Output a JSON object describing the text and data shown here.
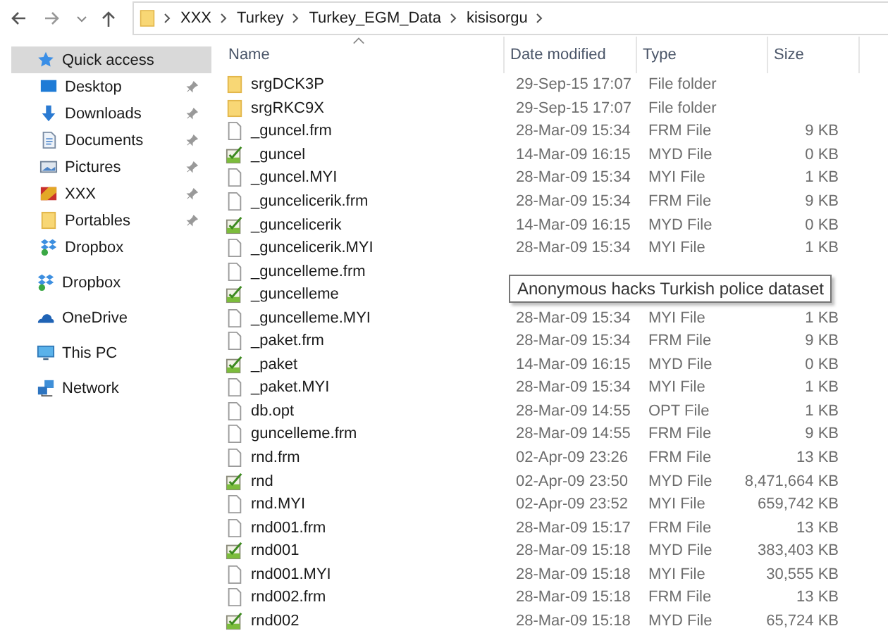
{
  "address_bar": {
    "crumbs": [
      "XXX",
      "Turkey",
      "Turkey_EGM_Data",
      "kisisorgu"
    ]
  },
  "sidebar": {
    "items": [
      {
        "label": "Quick access",
        "kind": "star",
        "selected": true,
        "children": [
          {
            "label": "Desktop",
            "kind": "desktop",
            "pinned": true
          },
          {
            "label": "Downloads",
            "kind": "download",
            "pinned": true
          },
          {
            "label": "Documents",
            "kind": "document",
            "pinned": true
          },
          {
            "label": "Pictures",
            "kind": "pictures",
            "pinned": true
          },
          {
            "label": "XXX",
            "kind": "app",
            "pinned": true
          },
          {
            "label": "Portables",
            "kind": "folder",
            "pinned": true
          },
          {
            "label": "Dropbox",
            "kind": "dropbox",
            "pinned": false
          }
        ]
      },
      {
        "label": "Dropbox",
        "kind": "dropbox",
        "selected": false
      },
      {
        "label": "OneDrive",
        "kind": "cloud",
        "selected": false
      },
      {
        "label": "This PC",
        "kind": "pc",
        "selected": false
      },
      {
        "label": "Network",
        "kind": "network",
        "selected": false
      }
    ]
  },
  "table": {
    "columns": [
      "Name",
      "Date modified",
      "Type",
      "Size"
    ],
    "rows": [
      {
        "kind": "folder",
        "name": "srgDCK3P",
        "date": "29-Sep-15 17:07",
        "type": "File folder"
      },
      {
        "kind": "folder",
        "name": "srgRKC9X",
        "date": "29-Sep-15 17:07",
        "type": "File folder"
      },
      {
        "kind": "file",
        "name": "_guncel.frm",
        "date": "28-Mar-09 15:34",
        "type": "FRM File",
        "size": "9 KB"
      },
      {
        "kind": "data",
        "name": "_guncel",
        "date": "14-Mar-09 16:15",
        "type": "MYD File",
        "size": "0 KB"
      },
      {
        "kind": "file",
        "name": "_guncel.MYI",
        "date": "28-Mar-09 15:34",
        "type": "MYI File",
        "size": "1 KB"
      },
      {
        "kind": "file",
        "name": "_guncelicerik.frm",
        "date": "28-Mar-09 15:34",
        "type": "FRM File",
        "size": "9 KB"
      },
      {
        "kind": "data",
        "name": "_guncelicerik",
        "date": "14-Mar-09 16:15",
        "type": "MYD File",
        "size": "0 KB"
      },
      {
        "kind": "file",
        "name": "_guncelicerik.MYI",
        "date": "28-Mar-09 15:34",
        "type": "MYI File",
        "size": "1 KB"
      },
      {
        "kind": "file",
        "name": "_guncelleme.frm"
      },
      {
        "kind": "data",
        "name": "_guncelleme"
      },
      {
        "kind": "file",
        "name": "_guncelleme.MYI",
        "date": "28-Mar-09 15:34",
        "type": "MYI File",
        "size": "1 KB"
      },
      {
        "kind": "file",
        "name": "_paket.frm",
        "date": "28-Mar-09 15:34",
        "type": "FRM File",
        "size": "9 KB"
      },
      {
        "kind": "data",
        "name": "_paket",
        "date": "14-Mar-09 16:15",
        "type": "MYD File",
        "size": "0 KB"
      },
      {
        "kind": "file",
        "name": "_paket.MYI",
        "date": "28-Mar-09 15:34",
        "type": "MYI File",
        "size": "1 KB"
      },
      {
        "kind": "file",
        "name": "db.opt",
        "date": "28-Mar-09 14:55",
        "type": "OPT File",
        "size": "1 KB"
      },
      {
        "kind": "file",
        "name": "guncelleme.frm",
        "date": "28-Mar-09 14:55",
        "type": "FRM File",
        "size": "9 KB"
      },
      {
        "kind": "file",
        "name": "rnd.frm",
        "date": "02-Apr-09 23:26",
        "type": "FRM File",
        "size": "13 KB"
      },
      {
        "kind": "data",
        "name": "rnd",
        "date": "02-Apr-09 23:50",
        "type": "MYD File",
        "size": "8,471,664 KB"
      },
      {
        "kind": "file",
        "name": "rnd.MYI",
        "date": "02-Apr-09 23:52",
        "type": "MYI File",
        "size": "659,742 KB"
      },
      {
        "kind": "file",
        "name": "rnd001.frm",
        "date": "28-Mar-09 15:17",
        "type": "FRM File",
        "size": "13 KB"
      },
      {
        "kind": "data",
        "name": "rnd001",
        "date": "28-Mar-09 15:18",
        "type": "MYD File",
        "size": "383,403 KB"
      },
      {
        "kind": "file",
        "name": "rnd001.MYI",
        "date": "28-Mar-09 15:18",
        "type": "MYI File",
        "size": "30,555 KB"
      },
      {
        "kind": "file",
        "name": "rnd002.frm",
        "date": "28-Mar-09 15:18",
        "type": "FRM File",
        "size": "13 KB"
      },
      {
        "kind": "data",
        "name": "rnd002",
        "date": "28-Mar-09 15:18",
        "type": "MYD File",
        "size": "65,724 KB"
      }
    ]
  },
  "tooltip": {
    "text": "Anonymous hacks Turkish police dataset"
  }
}
